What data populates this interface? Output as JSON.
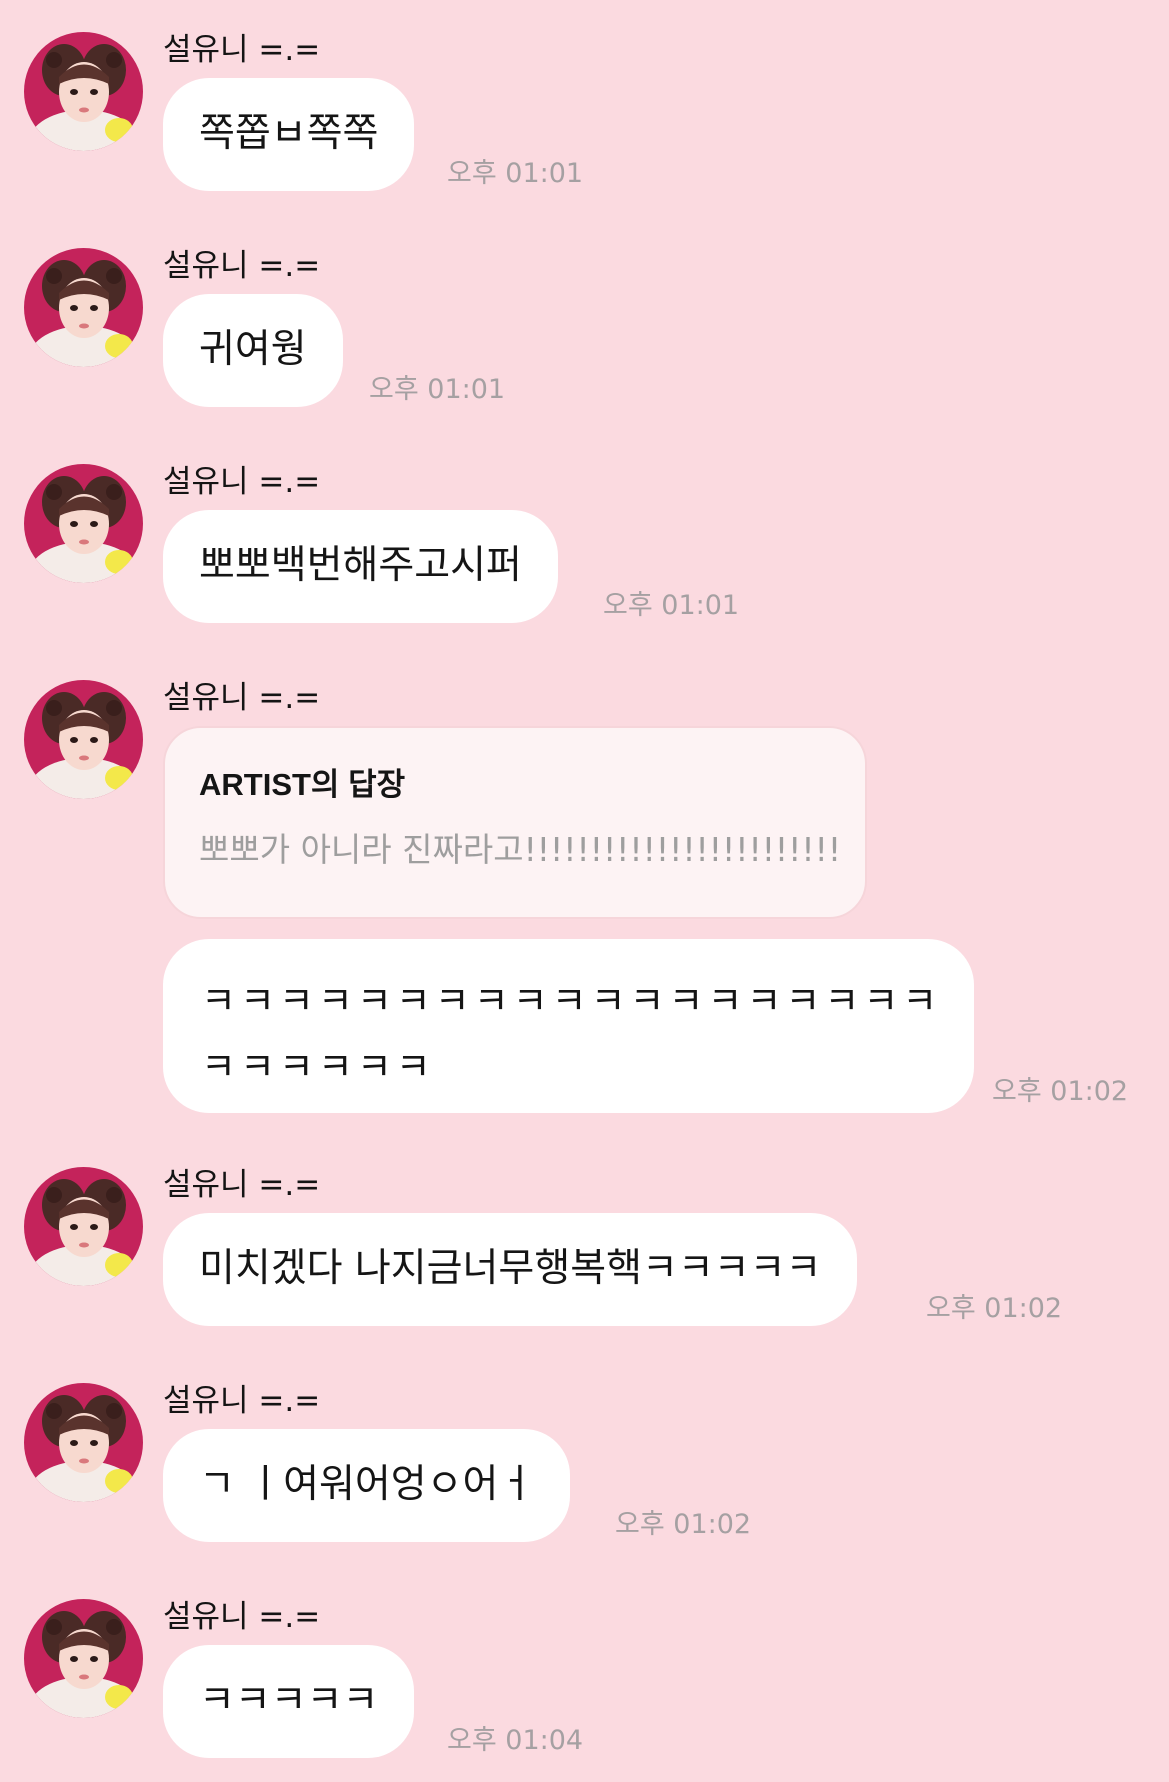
{
  "messages": [
    {
      "sender": "설유니 =.=",
      "text": "쪽쫍ㅂ쪽쪽",
      "time": "오후 01:01"
    },
    {
      "sender": "설유니 =.=",
      "text": "귀여웡",
      "time": "오후 01:01"
    },
    {
      "sender": "설유니 =.=",
      "text": "뽀뽀백번해주고시퍼",
      "time": "오후 01:01"
    },
    {
      "sender": "설유니 =.=",
      "reply": {
        "title": "ARTIST의 답장",
        "text": "뽀뽀가 아니라 진짜라고!!!!!!!!!!!!!!!!!!!!!!!!"
      },
      "text_line1": "ㅋㅋㅋㅋㅋㅋㅋㅋㅋㅋㅋㅋㅋㅋㅋㅋㅋㅋㅋ",
      "text_line2": "ㅋㅋㅋㅋㅋㅋ",
      "time": "오후 01:02"
    },
    {
      "sender": "설유니 =.=",
      "text": "미치겠다 나지금너무행복핵ㅋㅋㅋㅋㅋ",
      "time": "오후 01:02"
    },
    {
      "sender": "설유니 =.=",
      "text": "ㄱ ㅣ여워어엉ㅇ어ㅓ",
      "time": "오후 01:02"
    },
    {
      "sender": "설유니 =.=",
      "text": "ㅋㅋㅋㅋㅋ",
      "time": "오후 01:04"
    }
  ],
  "colors": {
    "background": "#fbdae0",
    "bubble": "#ffffff",
    "reply_card": "#fdf3f4",
    "timestamp": "#a5a0a2"
  },
  "icons": {
    "avatar": "profile-photo-avatar"
  }
}
